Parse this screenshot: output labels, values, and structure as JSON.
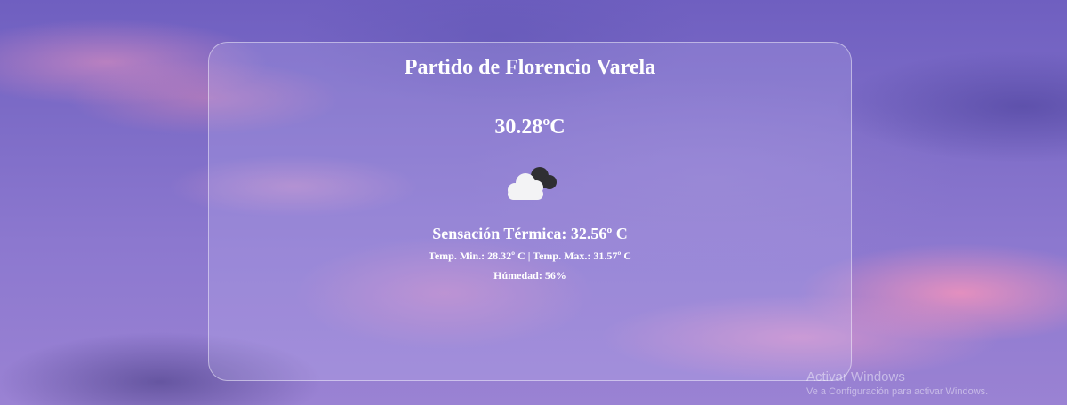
{
  "weather": {
    "city": "Partido de Florencio Varela",
    "temperature": "30.28ºC",
    "icon": "clouds-icon",
    "feels_like": "Sensación Térmica: 32.56º C",
    "min_max": "Temp. Min.: 28.32º C | Temp. Max.: 31.57º C",
    "humidity": "Húmedad: 56%"
  },
  "watermark": {
    "title": "Activar Windows",
    "subtitle": "Ve a Configuración para activar Windows."
  },
  "colors": {
    "background_top": "#6f5fc0",
    "background_bottom": "#9a82d3",
    "text": "#ffffff"
  }
}
